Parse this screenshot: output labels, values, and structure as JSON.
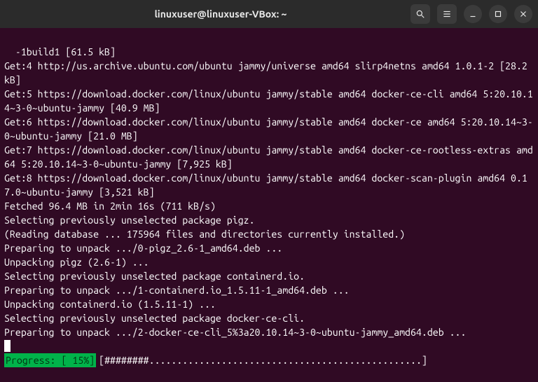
{
  "titlebar": {
    "title": "linuxuser@linuxuser-VBox: ~"
  },
  "terminal": {
    "lines": "-1build1 [61.5 kB]\nGet:4 http://us.archive.ubuntu.com/ubuntu jammy/universe amd64 slirp4netns amd64 1.0.1-2 [28.2 kB]\nGet:5 https://download.docker.com/linux/ubuntu jammy/stable amd64 docker-ce-cli amd64 5:20.10.14~3-0~ubuntu-jammy [40.9 MB]\nGet:6 https://download.docker.com/linux/ubuntu jammy/stable amd64 docker-ce amd64 5:20.10.14~3-0~ubuntu-jammy [21.0 MB]\nGet:7 https://download.docker.com/linux/ubuntu jammy/stable amd64 docker-ce-rootless-extras amd64 5:20.10.14~3-0~ubuntu-jammy [7,925 kB]\nGet:8 https://download.docker.com/linux/ubuntu jammy/stable amd64 docker-scan-plugin amd64 0.17.0~ubuntu-jammy [3,521 kB]\nFetched 96.4 MB in 2min 16s (711 kB/s)\nSelecting previously unselected package pigz.\n(Reading database ... 175964 files and directories currently installed.)\nPreparing to unpack .../0-pigz_2.6-1_amd64.deb ...\nUnpacking pigz (2.6-1) ...\nSelecting previously unselected package containerd.io.\nPreparing to unpack .../1-containerd.io_1.5.11-1_amd64.deb ...\nUnpacking containerd.io (1.5.11-1) ...\nSelecting previously unselected package docker-ce-cli.\nPreparing to unpack .../2-docker-ce-cli_5%3a20.10.14~3-0~ubuntu-jammy_amd64.deb ..."
  },
  "progress": {
    "label": "Progress: [ 15%]",
    "bar": "[########.................................................]"
  }
}
